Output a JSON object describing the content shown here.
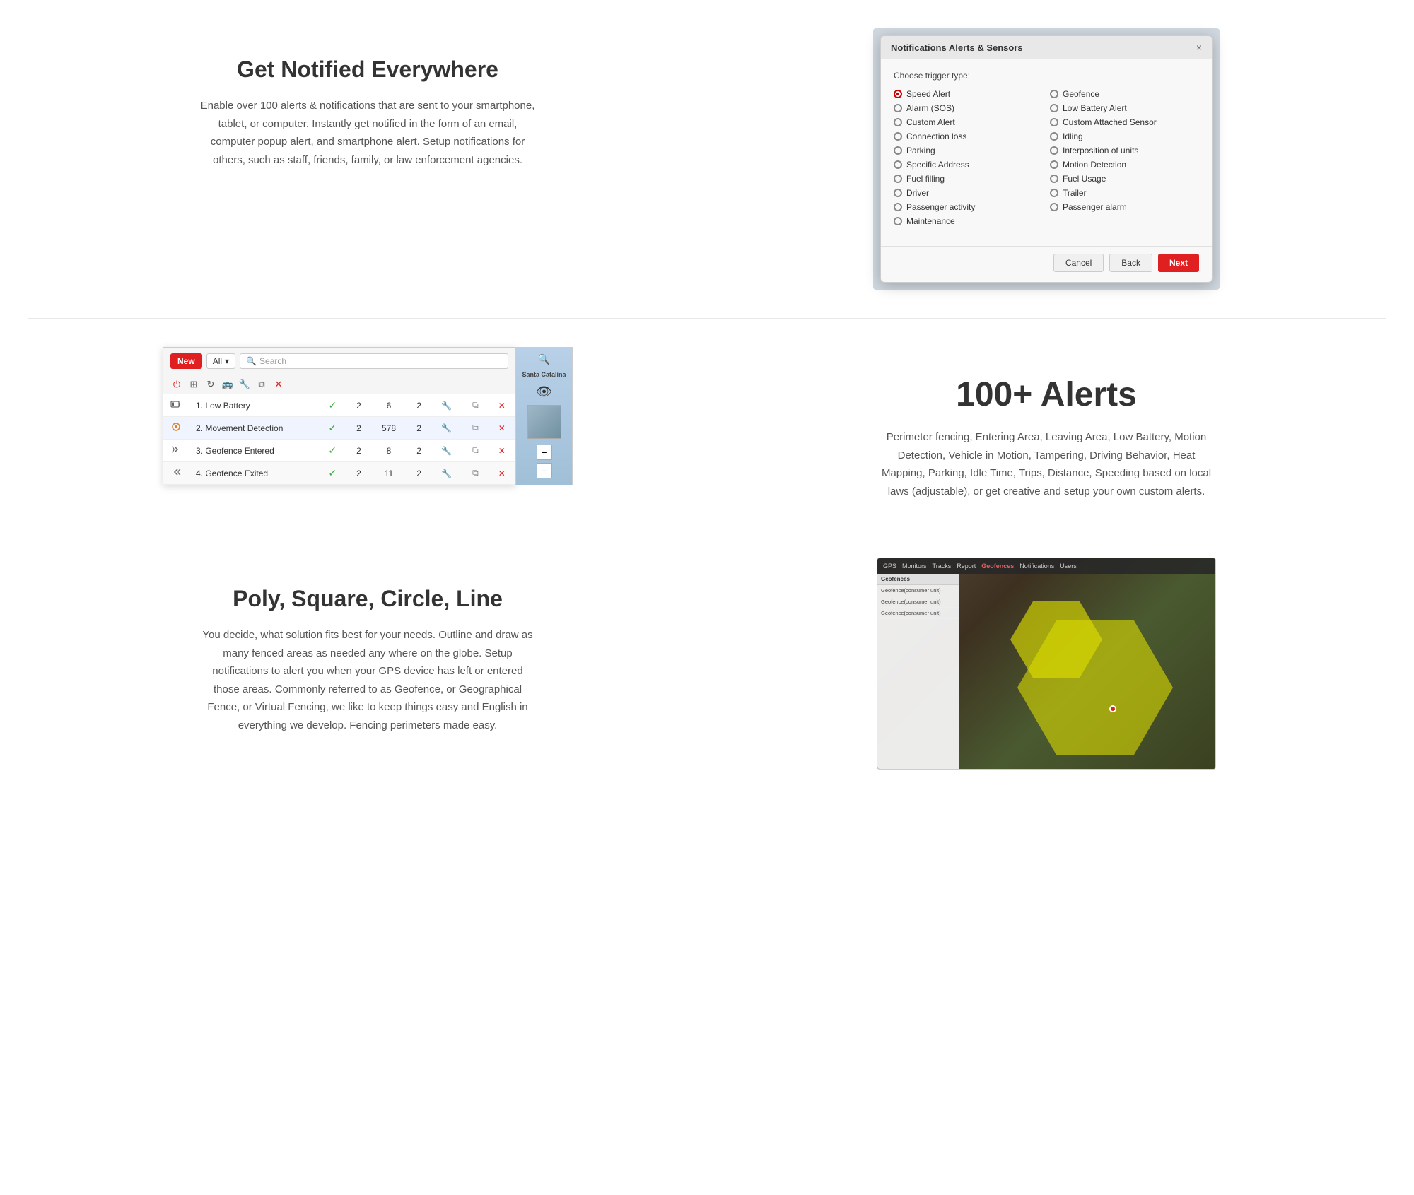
{
  "section1": {
    "heading": "Get Notified Everywhere",
    "paragraph": "Enable over 100 alerts & notifications that are sent to your smartphone, tablet, or computer. Instantly get notified in the form of an email, computer popup alert, and smartphone alert. Setup notifications for others, such as staff, friends, family, or law enforcement agencies.",
    "modal": {
      "title": "Notifications Alerts & Sensors",
      "close_label": "×",
      "trigger_label": "Choose trigger type:",
      "options": [
        {
          "label": "Speed Alert",
          "selected": true
        },
        {
          "label": "Geofence",
          "selected": false
        },
        {
          "label": "Alarm (SOS)",
          "selected": false
        },
        {
          "label": "Low Battery Alert",
          "selected": false
        },
        {
          "label": "Custom Alert",
          "selected": false
        },
        {
          "label": "Custom Attached Sensor",
          "selected": false
        },
        {
          "label": "Connection loss",
          "selected": false
        },
        {
          "label": "Idling",
          "selected": false
        },
        {
          "label": "Parking",
          "selected": false
        },
        {
          "label": "Interposition of units",
          "selected": false
        },
        {
          "label": "Specific Address",
          "selected": false
        },
        {
          "label": "Motion Detection",
          "selected": false
        },
        {
          "label": "Fuel filling",
          "selected": false
        },
        {
          "label": "Fuel Usage",
          "selected": false
        },
        {
          "label": "Driver",
          "selected": false
        },
        {
          "label": "Trailer",
          "selected": false
        },
        {
          "label": "Passenger activity",
          "selected": false
        },
        {
          "label": "Passenger alarm",
          "selected": false
        },
        {
          "label": "Maintenance",
          "selected": false
        }
      ],
      "cancel_label": "Cancel",
      "back_label": "Back",
      "next_label": "Next"
    }
  },
  "section2": {
    "heading": "100+ Alerts",
    "paragraph": "Perimeter fencing, Entering Area, Leaving Area, Low Battery, Motion Detection, Vehicle in Motion, Tampering, Driving Behavior, Heat Mapping, Parking, Idle Time, Trips, Distance, Speeding based on local laws (adjustable), or get creative and setup your own custom alerts.",
    "panel": {
      "new_label": "New",
      "dropdown_label": "All",
      "search_placeholder": "Search",
      "rows": [
        {
          "icon": "battery",
          "name": "1. Low Battery",
          "check": true,
          "n1": 2,
          "n2": 6,
          "n3": 2
        },
        {
          "icon": "movement",
          "name": "2. Movement Detection",
          "check": true,
          "n1": 2,
          "n2": 578,
          "n3": 2
        },
        {
          "icon": "geofence-enter",
          "name": "3. Geofence Entered",
          "check": true,
          "n1": 2,
          "n2": 8,
          "n3": 2
        },
        {
          "icon": "geofence-exit",
          "name": "4. Geofence Exited",
          "check": true,
          "n1": 2,
          "n2": 11,
          "n3": 2
        }
      ]
    }
  },
  "section3": {
    "heading": "Poly, Square, Circle, Line",
    "paragraph": "You decide, what solution fits best for your needs. Outline and draw as many fenced areas as needed any where on the globe. Setup notifications to alert you when your GPS device has left or entered those areas. Commonly referred to as Geofence, or Geographical Fence, or Virtual Fencing, we like to keep things easy and English in everything we develop. Fencing perimeters made easy.",
    "map": {
      "toolbar_items": [
        "GPS",
        "Monitors",
        "Tracks",
        "Report",
        "Notifications",
        "Users"
      ]
    }
  }
}
